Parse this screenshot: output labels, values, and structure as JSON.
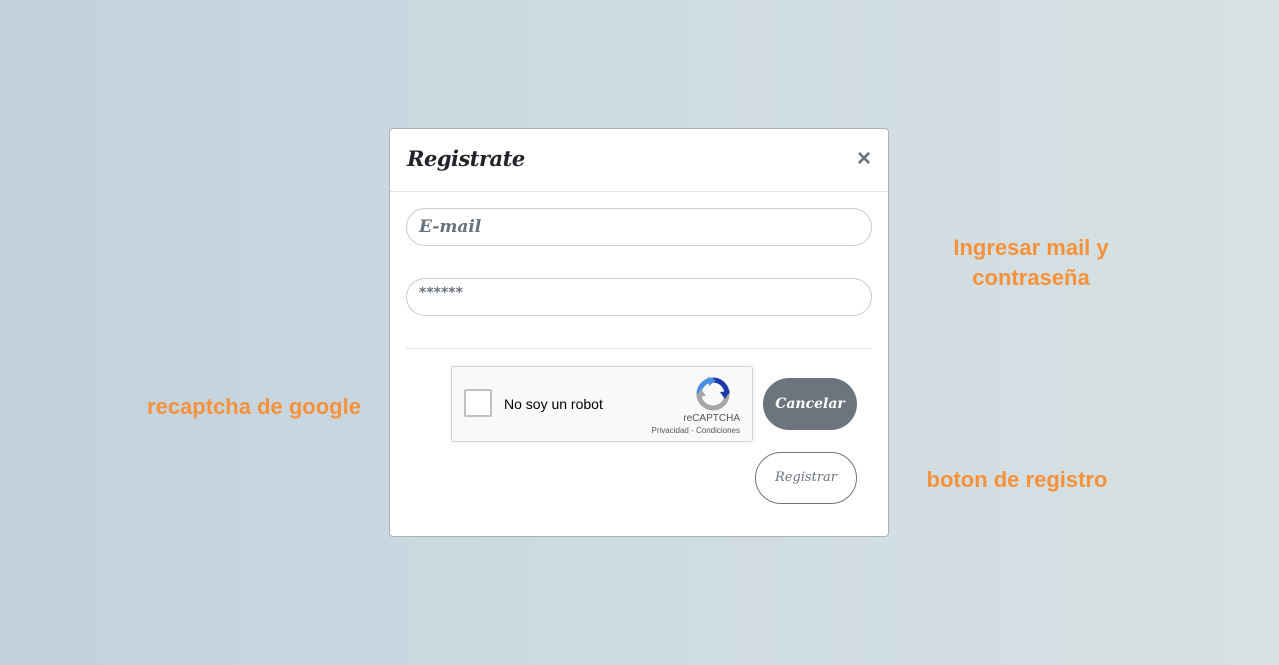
{
  "modal": {
    "title": "Registrate",
    "close_glyph": "×",
    "email_placeholder": "E-mail",
    "password_value": "******",
    "cancel_label": "Cancelar",
    "register_label": "Registrar"
  },
  "recaptcha": {
    "label": "No soy un robot",
    "brand": "reCAPTCHA",
    "links": "Privacidad - Condiciones",
    "icon": "recaptcha-logo-icon"
  },
  "annotations": {
    "mail_password": "Ingresar mail y contraseña",
    "recaptcha": "recaptcha de google",
    "register_button": "boton de registro"
  },
  "colors": {
    "annotation": "#f7913a",
    "button_secondary": "#6c757d"
  }
}
